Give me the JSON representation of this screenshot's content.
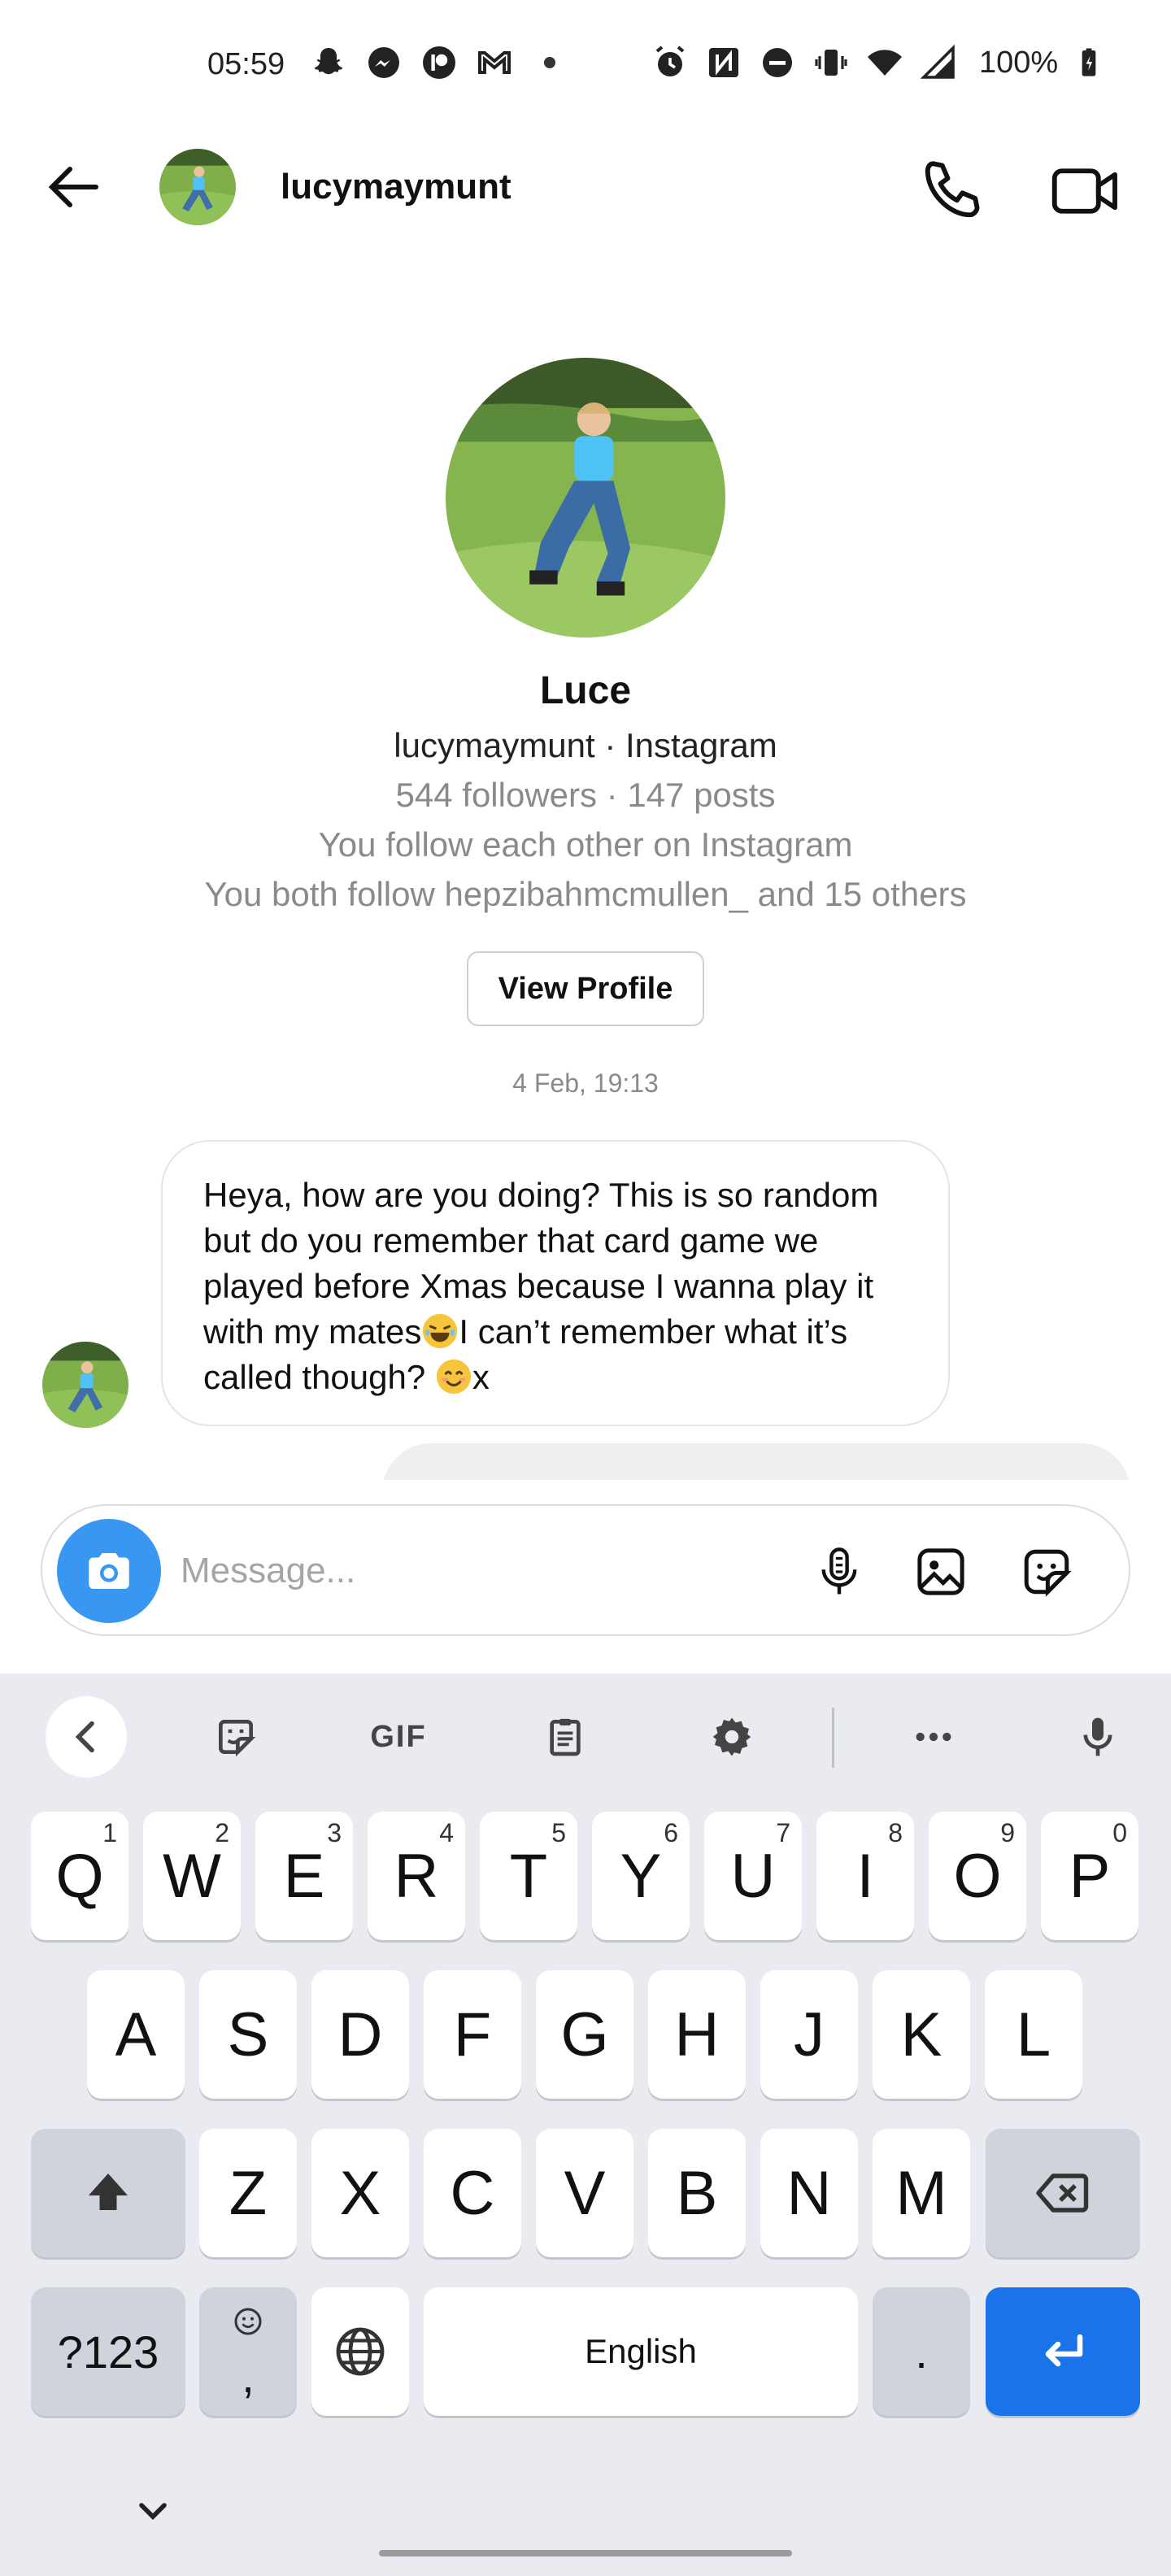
{
  "status_bar": {
    "time": "05:59",
    "battery": "100%",
    "left_icons": [
      "snapchat-icon",
      "messenger-icon",
      "patreon-icon",
      "gmail-icon",
      "dot-icon"
    ],
    "right_icons": [
      "alarm-icon",
      "nfc-icon",
      "dnd-icon",
      "vibrate-icon",
      "wifi-icon",
      "signal-icon",
      "battery-icon"
    ]
  },
  "header": {
    "username": "lucymaymunt"
  },
  "profile": {
    "name": "Luce",
    "handle": "lucymaymunt · Instagram",
    "stats": "544 followers · 147 posts",
    "mutual_follow": "You follow each other on Instagram",
    "mutual_friends": "You both follow hepzibahmcmullen_ and 15 others",
    "view_profile_label": "View Profile"
  },
  "thread": {
    "timestamp": "4 Feb, 19:13",
    "message_lines": [
      "Heya, how are you doing? This is so random",
      "but do you remember that card game we",
      "played before Xmas because I wanna play it",
      "with my mates",
      "I can’t remember what it’s",
      "called though? ",
      "x"
    ]
  },
  "composer": {
    "placeholder": "Message..."
  },
  "keyboard": {
    "toolbar": [
      "back-icon",
      "sticker-icon",
      "GIF",
      "clipboard-icon",
      "settings-icon",
      "more-icon",
      "mic-icon"
    ],
    "gif_label": "GIF",
    "row1": [
      "Q",
      "W",
      "E",
      "R",
      "T",
      "Y",
      "U",
      "I",
      "O",
      "P"
    ],
    "row1_nums": [
      "1",
      "2",
      "3",
      "4",
      "5",
      "6",
      "7",
      "8",
      "9",
      "0"
    ],
    "row2": [
      "A",
      "S",
      "D",
      "F",
      "G",
      "H",
      "J",
      "K",
      "L"
    ],
    "row3": [
      "Z",
      "X",
      "C",
      "V",
      "B",
      "N",
      "M"
    ],
    "sym_label": "?123",
    "comma_label": ",",
    "space_label": "English",
    "period_label": ".",
    "accent_color": "#1a73e8"
  }
}
